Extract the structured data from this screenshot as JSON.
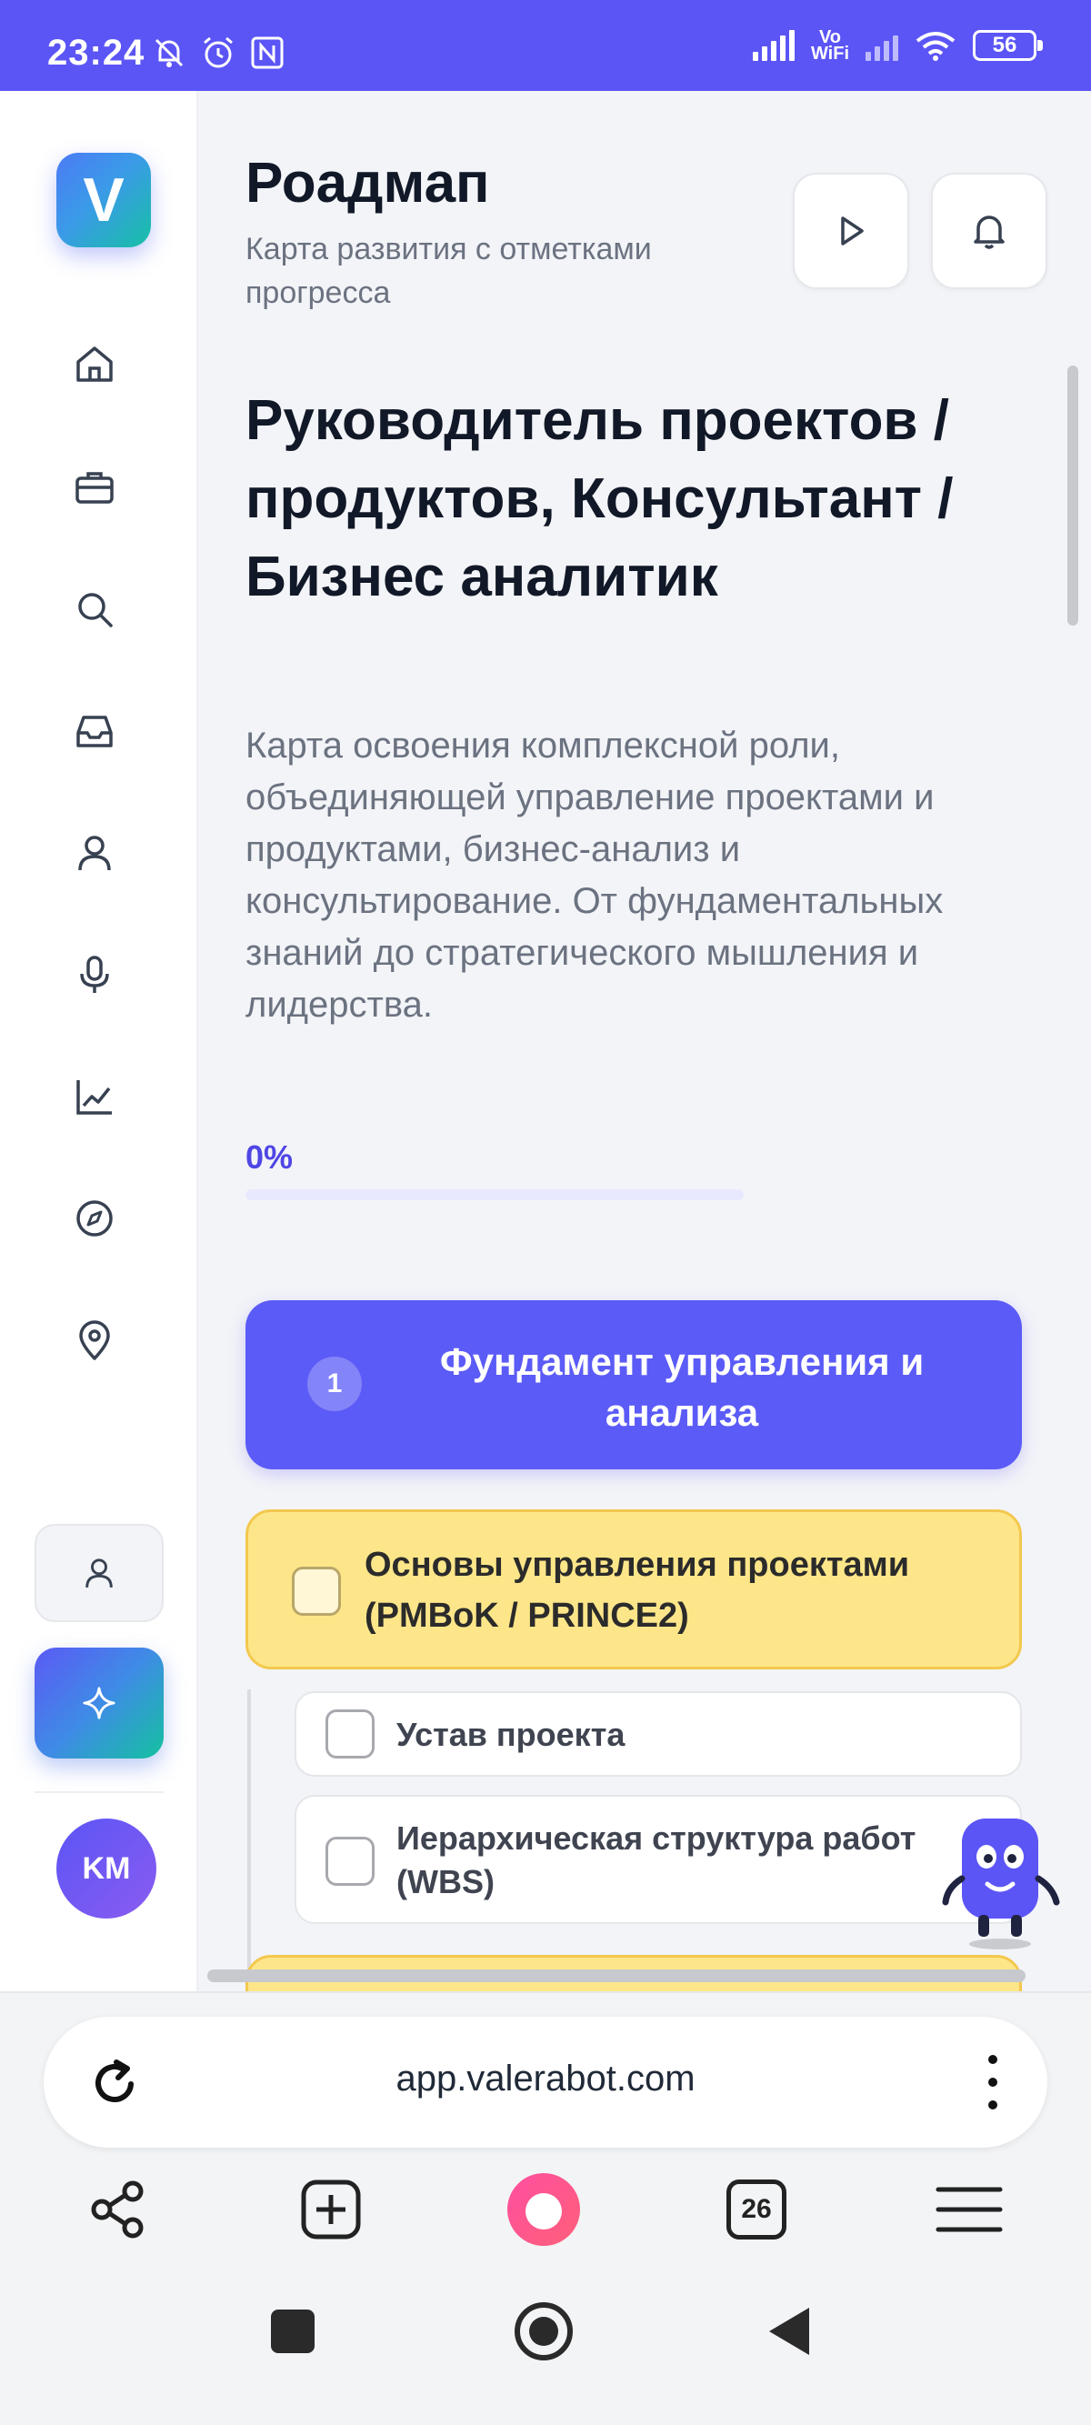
{
  "status_bar": {
    "time": "23:24",
    "vowifi_line1": "Vo",
    "vowifi_line2": "WiFi",
    "battery": "56",
    "icons": [
      "silent-icon",
      "alarm-icon",
      "nfc-icon",
      "signal-icon",
      "vowifi-icon",
      "signal-2-icon",
      "wifi-icon",
      "battery-icon"
    ]
  },
  "sidebar": {
    "logo_letter": "V",
    "items": [
      {
        "icon": "home-icon"
      },
      {
        "icon": "briefcase-icon"
      },
      {
        "icon": "search-icon"
      },
      {
        "icon": "inbox-icon"
      },
      {
        "icon": "user-icon"
      },
      {
        "icon": "microphone-icon"
      },
      {
        "icon": "chart-icon"
      },
      {
        "icon": "compass-icon"
      },
      {
        "icon": "location-icon"
      }
    ],
    "avatar_initials": "KM"
  },
  "header": {
    "title": "Роадмап",
    "subtitle": "Карта развития с отметками прогресса"
  },
  "roadmap": {
    "title": "Руководитель проектов / продуктов, Консультант / Бизнес аналитик",
    "description": "Карта освоения комплексной роли, объединяющей управление проектами и продуктами, бизнес-анализ и консультирование. От фундаментальных знаний до стратегического мышления и лидерства.",
    "progress_label": "0%",
    "progress_value": 0,
    "stage": {
      "number": "1",
      "title": "Фундамент управления и анализа"
    },
    "topic": {
      "title": "Основы управления проектами (PMBoK / PRINCE2)",
      "checked": false,
      "subitems": [
        {
          "title": "Устав проекта",
          "checked": false
        },
        {
          "title": "Иерархическая структура работ (WBS)",
          "checked": false
        }
      ]
    }
  },
  "browser": {
    "url": "app.valerabot.com",
    "tabs_count": "26"
  },
  "colors": {
    "accent": "#5b55f6",
    "topic_bg": "#fde689",
    "stage_bg": "#5b5bf7"
  }
}
